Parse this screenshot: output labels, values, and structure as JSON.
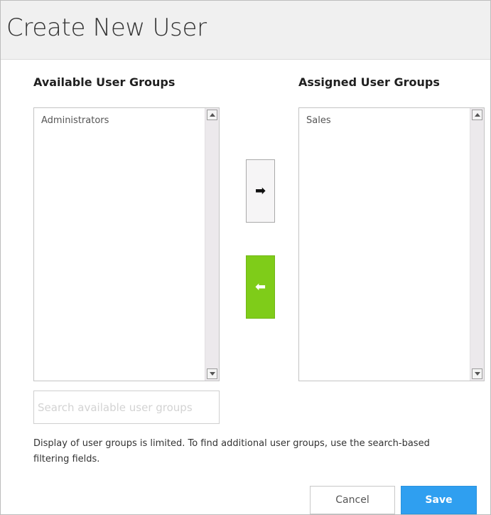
{
  "dialog": {
    "title": "Create New User"
  },
  "available": {
    "heading": "Available User Groups",
    "items": [
      "Administrators"
    ],
    "search_placeholder": "Search available user groups"
  },
  "assigned": {
    "heading": "Assigned User Groups",
    "items": [
      "Sales"
    ]
  },
  "transfer": {
    "add_icon": "arrow-right-icon",
    "remove_icon": "arrow-left-icon",
    "add_glyph": "➡",
    "remove_glyph": "⬅"
  },
  "help_text": "Display of user groups is limited. To find additional user groups, use the search-based filtering fields.",
  "actions": {
    "cancel_label": "Cancel",
    "save_label": "Save"
  },
  "colors": {
    "remove_button": "#7fcc19",
    "save_button": "#2f9ff0",
    "header_bg": "#f0f0f0"
  }
}
